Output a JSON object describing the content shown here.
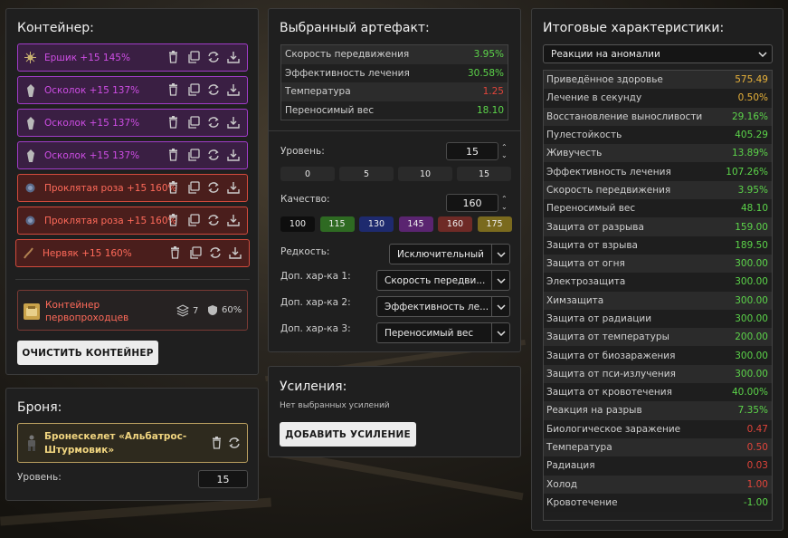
{
  "colors": {
    "purple": "#a03cc8",
    "red": "#d24a3c",
    "green": "#5cd44a",
    "negative": "#e0443a",
    "orange": "#e8b23a",
    "gold_border": "#bba060"
  },
  "container": {
    "title": "Контейнер:",
    "items": [
      {
        "name": "Ершик +15 145%",
        "rarity": "purple",
        "icon": "urchin-artifact-icon"
      },
      {
        "name": "Осколок +15 137%",
        "rarity": "purple",
        "icon": "shard-artifact-icon"
      },
      {
        "name": "Осколок +15 137%",
        "rarity": "purple",
        "icon": "shard-artifact-icon"
      },
      {
        "name": "Осколок +15 137%",
        "rarity": "purple",
        "icon": "shard-artifact-icon"
      },
      {
        "name": "Проклятая роза +15 160%",
        "rarity": "red",
        "icon": "rose-artifact-icon"
      },
      {
        "name": "Проклятая роза +15 160%",
        "rarity": "red",
        "icon": "rose-artifact-icon"
      },
      {
        "name": "Нервяк +15 160%",
        "rarity": "red",
        "icon": "nerve-artifact-icon"
      }
    ],
    "item_actions": [
      "trash-icon",
      "copy-icon",
      "swap-icon",
      "download-icon"
    ],
    "selected": {
      "name_line1": "Контейнер",
      "name_line2": "первопроходцев",
      "slots": "7",
      "protection": "60%"
    },
    "clear_button": "ОЧИСТИТЬ КОНТЕЙНЕР"
  },
  "armor": {
    "title": "Броня:",
    "name_line1": "Бронескелет «Альбатрос-",
    "name_line2": "Штурмовик»",
    "level_label": "Уровень:",
    "level_value": "15"
  },
  "artifact": {
    "title": "Выбранный артефакт:",
    "stats": [
      {
        "label": "Скорость передвижения",
        "value": "3.95%",
        "tone": "green"
      },
      {
        "label": "Эффективность лечения",
        "value": "30.58%",
        "tone": "green"
      },
      {
        "label": "Температура",
        "value": "1.25",
        "tone": "red"
      },
      {
        "label": "Переносимый вес",
        "value": "18.10",
        "tone": "green"
      }
    ],
    "level_label": "Уровень:",
    "level_value": "15",
    "level_presets": [
      "0",
      "5",
      "10",
      "15"
    ],
    "quality_label": "Качество:",
    "quality_value": "160",
    "quality_presets": [
      {
        "label": "100",
        "color": "#0e0e0e"
      },
      {
        "label": "115",
        "color": "#2e6a22"
      },
      {
        "label": "130",
        "color": "#1e2a6e"
      },
      {
        "label": "145",
        "color": "#5a2470"
      },
      {
        "label": "160",
        "color": "#6e2a26"
      },
      {
        "label": "175",
        "color": "#7a6a1e"
      }
    ],
    "rarity_label": "Редкость:",
    "rarity_value": "Исключительный",
    "extra_label_1": "Доп. хар-ка 1:",
    "extra_value_1": "Скорость передви...",
    "extra_label_2": "Доп. хар-ка 2:",
    "extra_value_2": "Эффективность ле...",
    "extra_label_3": "Доп. хар-ка 3:",
    "extra_value_3": "Переносимый вес"
  },
  "boosts": {
    "title": "Усиления:",
    "empty_text": "Нет выбранных усилений",
    "add_button": "ДОБАВИТЬ УСИЛЕНИЕ"
  },
  "totals": {
    "title": "Итоговые характеристики:",
    "filter_value": "Реакции на аномалии",
    "rows": [
      {
        "label": "Приведённое здоровье",
        "value": "575.49",
        "tone": "orange"
      },
      {
        "label": "Лечение в секунду",
        "value": "0.50%",
        "tone": "orange"
      },
      {
        "label": "Восстановление выносливости",
        "value": "29.16%",
        "tone": "green"
      },
      {
        "label": "Пулестойкость",
        "value": "405.29",
        "tone": "green"
      },
      {
        "label": "Живучесть",
        "value": "13.89%",
        "tone": "green"
      },
      {
        "label": "Эффективность лечения",
        "value": "107.26%",
        "tone": "green"
      },
      {
        "label": "Скорость передвижения",
        "value": "3.95%",
        "tone": "green"
      },
      {
        "label": "Переносимый вес",
        "value": "48.10",
        "tone": "green"
      },
      {
        "label": "Защита от разрыва",
        "value": "159.00",
        "tone": "green"
      },
      {
        "label": "Защита от взрыва",
        "value": "189.50",
        "tone": "green"
      },
      {
        "label": "Защита от огня",
        "value": "300.00",
        "tone": "green"
      },
      {
        "label": "Электрозащита",
        "value": "300.00",
        "tone": "green"
      },
      {
        "label": "Химзащита",
        "value": "300.00",
        "tone": "green"
      },
      {
        "label": "Защита от радиации",
        "value": "300.00",
        "tone": "green"
      },
      {
        "label": "Защита от температуры",
        "value": "200.00",
        "tone": "green"
      },
      {
        "label": "Защита от биозаражения",
        "value": "300.00",
        "tone": "green"
      },
      {
        "label": "Защита от пси-излучения",
        "value": "300.00",
        "tone": "green"
      },
      {
        "label": "Защита от кровотечения",
        "value": "40.00%",
        "tone": "green"
      },
      {
        "label": "Реакция на разрыв",
        "value": "7.35%",
        "tone": "green"
      },
      {
        "label": "Биологическое заражение",
        "value": "0.47",
        "tone": "red"
      },
      {
        "label": "Температура",
        "value": "0.50",
        "tone": "red"
      },
      {
        "label": "Радиация",
        "value": "0.03",
        "tone": "red"
      },
      {
        "label": "Холод",
        "value": "1.00",
        "tone": "red"
      },
      {
        "label": "Кровотечение",
        "value": "-1.00",
        "tone": "green"
      }
    ]
  }
}
